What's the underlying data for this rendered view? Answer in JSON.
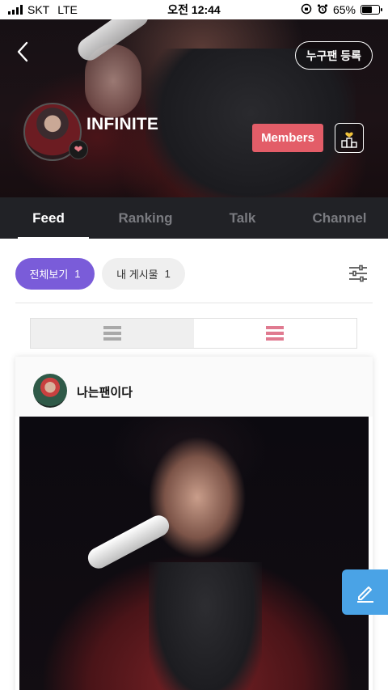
{
  "status_bar": {
    "carrier": "SKT",
    "network": "LTE",
    "time": "오전 12:44",
    "battery": "65%",
    "battery_level": 0.65
  },
  "header": {
    "group_name": "INFINITE",
    "register_label": "누구팬 등록",
    "members_label": "Members"
  },
  "tabs": [
    {
      "label": "Feed",
      "active": true
    },
    {
      "label": "Ranking",
      "active": false
    },
    {
      "label": "Talk",
      "active": false
    },
    {
      "label": "Channel",
      "active": false
    }
  ],
  "filters": {
    "all": {
      "label": "전체보기",
      "count": "1"
    },
    "mine": {
      "label": "내 게시물",
      "count": "1"
    }
  },
  "colors": {
    "accent_purple": "#7a5cd9",
    "members_red": "#e35d68",
    "card_view_pink": "#e07a90",
    "fab_blue": "#4aa3e6",
    "tab_bar_bg": "#212226"
  },
  "post": {
    "author": "나는팬이다"
  },
  "icons": {
    "back": "chevron-left-icon",
    "heart": "broken-heart-icon",
    "ranking": "podium-icon",
    "filter": "sliders-icon",
    "list_view": "list-view-icon",
    "card_view": "card-view-icon",
    "write": "pencil-icon"
  }
}
